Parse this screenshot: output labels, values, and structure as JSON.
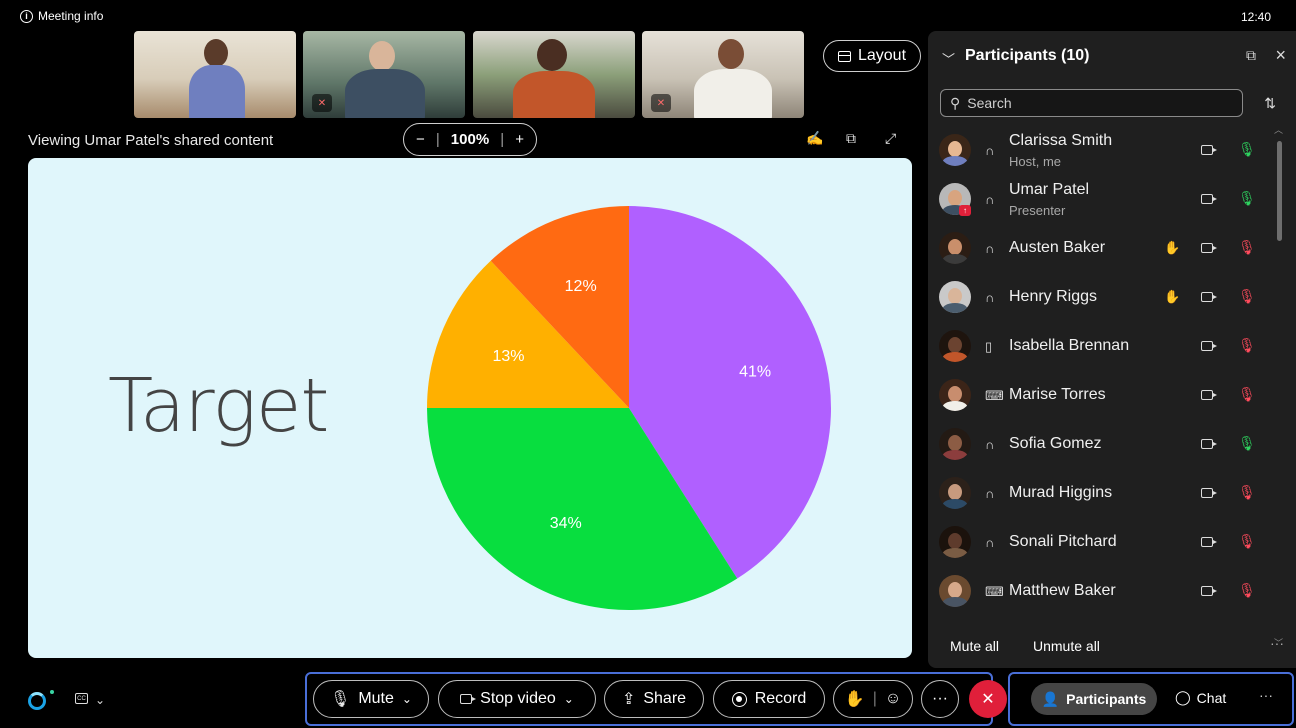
{
  "topbar": {
    "meeting_info": "Meeting info",
    "time": "12:40"
  },
  "layout_button": "Layout",
  "share": {
    "label": "Viewing Umar Patel's shared content",
    "zoom_minus": "−",
    "zoom_value": "100%",
    "zoom_plus": "+"
  },
  "slide": {
    "title": "Target",
    "chart_data": {
      "type": "pie",
      "values": [
        41,
        34,
        13,
        12
      ],
      "labels": [
        "41%",
        "34%",
        "13%",
        "12%"
      ],
      "colors": [
        "#b060ff",
        "#08de3f",
        "#ffb000",
        "#ff6a12"
      ]
    }
  },
  "panel": {
    "title": "Participants (10)",
    "search_placeholder": "Search",
    "participants": [
      {
        "name": "Clarissa Smith",
        "role": "Host, me",
        "device": "headset",
        "hand": false,
        "mic": "on"
      },
      {
        "name": "Umar Patel",
        "role": "Presenter",
        "device": "headset",
        "hand": false,
        "mic": "on"
      },
      {
        "name": "Austen Baker",
        "role": "",
        "device": "headset",
        "hand": true,
        "mic": "off"
      },
      {
        "name": "Henry Riggs",
        "role": "",
        "device": "headset",
        "hand": true,
        "mic": "off"
      },
      {
        "name": "Isabella Brennan",
        "role": "",
        "device": "phone",
        "hand": false,
        "mic": "off"
      },
      {
        "name": "Marise Torres",
        "role": "",
        "device": "laptop",
        "hand": false,
        "mic": "off"
      },
      {
        "name": "Sofia Gomez",
        "role": "",
        "device": "headset",
        "hand": false,
        "mic": "on"
      },
      {
        "name": "Murad Higgins",
        "role": "",
        "device": "headset",
        "hand": false,
        "mic": "off"
      },
      {
        "name": "Sonali Pitchard",
        "role": "",
        "device": "headset",
        "hand": false,
        "mic": "off"
      },
      {
        "name": "Matthew Baker",
        "role": "",
        "device": "laptop",
        "hand": false,
        "mic": "off"
      }
    ],
    "mute_all": "Mute all",
    "unmute_all": "Unmute all"
  },
  "controls": {
    "mute": "Mute",
    "stop_video": "Stop video",
    "share": "Share",
    "record": "Record"
  },
  "tabs": {
    "participants": "Participants",
    "chat": "Chat"
  }
}
